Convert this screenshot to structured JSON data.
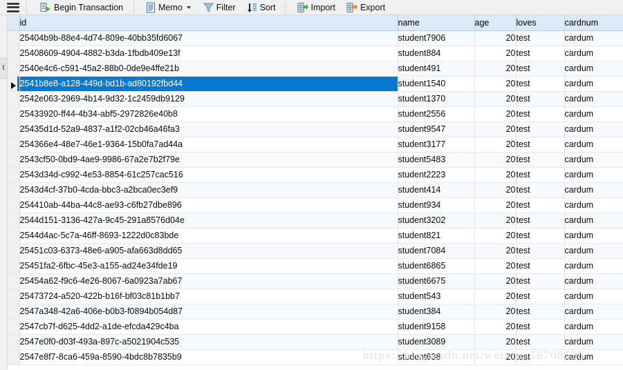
{
  "toolbar": {
    "menu_icon": "hamburger-menu-icon",
    "buttons": [
      {
        "label": "Begin Transaction",
        "icon": "begin-transaction-icon",
        "dropdown": false
      },
      {
        "label": "Memo",
        "icon": "memo-icon",
        "dropdown": true
      },
      {
        "label": "Filter",
        "icon": "filter-funnel-icon",
        "dropdown": false
      },
      {
        "label": "Sort",
        "icon": "sort-icon",
        "dropdown": false
      },
      {
        "label": "Import",
        "icon": "import-icon",
        "dropdown": false
      },
      {
        "label": "Export",
        "icon": "export-icon",
        "dropdown": false
      }
    ]
  },
  "left_rail": {
    "tab_label": "t"
  },
  "grid": {
    "columns": [
      {
        "key": "id",
        "label": "id",
        "align": "left"
      },
      {
        "key": "name",
        "label": "name",
        "align": "left"
      },
      {
        "key": "age",
        "label": "age",
        "align": "right"
      },
      {
        "key": "loves",
        "label": "loves",
        "align": "left"
      },
      {
        "key": "cardnum",
        "label": "cardnum",
        "align": "left"
      }
    ],
    "selected_row_index": 3,
    "rows": [
      {
        "id": "25404b9b-88e4-4d74-809e-40bb35fd6067",
        "name": "student7906",
        "age": "20",
        "loves": "test",
        "cardnum": "cardum"
      },
      {
        "id": "25408609-4904-4882-b3da-1fbdb409e13f",
        "name": "student884",
        "age": "20",
        "loves": "test",
        "cardnum": "cardum"
      },
      {
        "id": "2540e4c6-c591-45a2-88b0-0de9e4ffe21b",
        "name": "student491",
        "age": "20",
        "loves": "test",
        "cardnum": "cardum"
      },
      {
        "id": "2541b8e8-a128-449d-bd1b-ad80192fbd44",
        "name": "student1540",
        "age": "20",
        "loves": "test",
        "cardnum": "cardum"
      },
      {
        "id": "2542e063-2969-4b14-9d32-1c2459db9129",
        "name": "student1370",
        "age": "20",
        "loves": "test",
        "cardnum": "cardum"
      },
      {
        "id": "25433920-ff44-4b34-abf5-2972826e40b8",
        "name": "student2556",
        "age": "20",
        "loves": "test",
        "cardnum": "cardum"
      },
      {
        "id": "25435d1d-52a9-4837-a1f2-02cb46a46fa3",
        "name": "student9547",
        "age": "20",
        "loves": "test",
        "cardnum": "cardum"
      },
      {
        "id": "254366e4-48e7-46e1-9364-15b0fa7ad44a",
        "name": "student3177",
        "age": "20",
        "loves": "test",
        "cardnum": "cardum"
      },
      {
        "id": "2543cf50-0bd9-4ae9-9986-67a2e7b2f79e",
        "name": "student5483",
        "age": "20",
        "loves": "test",
        "cardnum": "cardum"
      },
      {
        "id": "2543d34d-c992-4e53-8854-61c257cac516",
        "name": "student2223",
        "age": "20",
        "loves": "test",
        "cardnum": "cardum"
      },
      {
        "id": "2543d4cf-37b0-4cda-bbc3-a2bca0ec3ef9",
        "name": "student414",
        "age": "20",
        "loves": "test",
        "cardnum": "cardum"
      },
      {
        "id": "254410ab-44ba-44c8-ae93-c6fb27dbe896",
        "name": "student934",
        "age": "20",
        "loves": "test",
        "cardnum": "cardum"
      },
      {
        "id": "2544d151-3136-427a-9c45-291a8576d04e",
        "name": "student3202",
        "age": "20",
        "loves": "test",
        "cardnum": "cardum"
      },
      {
        "id": "2544d4ac-5c7a-46ff-8693-1222d0c83bde",
        "name": "student821",
        "age": "20",
        "loves": "test",
        "cardnum": "cardum"
      },
      {
        "id": "25451c03-6373-48e6-a905-afa663d8dd65",
        "name": "student7084",
        "age": "20",
        "loves": "test",
        "cardnum": "cardum"
      },
      {
        "id": "25451fa2-6fbc-45e3-a155-ad24e34fde19",
        "name": "student6865",
        "age": "20",
        "loves": "test",
        "cardnum": "cardum"
      },
      {
        "id": "25454a62-f9c6-4e26-8067-6a0923a7ab67",
        "name": "student6675",
        "age": "20",
        "loves": "test",
        "cardnum": "cardum"
      },
      {
        "id": "25473724-a520-422b-b16f-bf03c81b1bb7",
        "name": "student543",
        "age": "20",
        "loves": "test",
        "cardnum": "cardum"
      },
      {
        "id": "2547a348-42a6-406e-b0b3-f0894b054d87",
        "name": "student384",
        "age": "20",
        "loves": "test",
        "cardnum": "cardum"
      },
      {
        "id": "2547cb7f-d625-4dd2-a1de-efcda429c4ba",
        "name": "student9158",
        "age": "20",
        "loves": "test",
        "cardnum": "cardum"
      },
      {
        "id": "2547e0f0-d03f-493a-897c-a5021904c535",
        "name": "student3089",
        "age": "20",
        "loves": "test",
        "cardnum": "cardum"
      },
      {
        "id": "2547e8f7-8ca6-459a-8590-4bdc8b7835b9",
        "name": "student638",
        "age": "20",
        "loves": "test",
        "cardnum": "cardum"
      }
    ]
  },
  "watermark": {
    "text": "https://blog.csdn.net/weixin_36708538"
  },
  "colors": {
    "selection": "#0b78d0",
    "header_bg": "#dce9f7",
    "toolbar_bg": "#f0f0f0",
    "row_alt_bg": "#f7fafd"
  }
}
